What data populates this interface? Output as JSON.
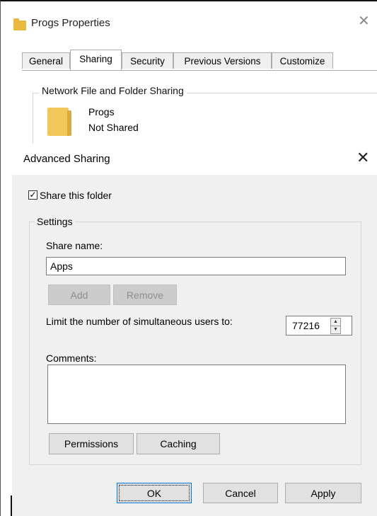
{
  "properties_window": {
    "title": "Progs Properties",
    "close_glyph": "✕",
    "tabs": [
      {
        "label": "General"
      },
      {
        "label": "Sharing",
        "active": true
      },
      {
        "label": "Security"
      },
      {
        "label": "Previous Versions"
      },
      {
        "label": "Customize"
      }
    ],
    "group_label": "Network File and Folder Sharing",
    "folder_name": "Progs",
    "share_status": "Not Shared",
    "icons": [
      "folder-icon"
    ]
  },
  "advanced_sharing": {
    "title": "Advanced Sharing",
    "close_glyph": "✕",
    "share_folder": {
      "label": "Share this folder",
      "checked": true
    },
    "settings_label": "Settings",
    "share_name_label": "Share name:",
    "share_name_value": "Apps",
    "add_label": "Add",
    "remove_label": "Remove",
    "limit_label": "Limit the number of simultaneous users to:",
    "limit_value": "77216",
    "comments_label": "Comments:",
    "comments_value": "",
    "permissions_label": "Permissions",
    "caching_label": "Caching",
    "ok_label": "OK",
    "cancel_label": "Cancel",
    "apply_label": "Apply"
  },
  "colors": {
    "dialog_bg": "#f0f0f0",
    "button_bg": "#e1e1e1",
    "disabled_button_bg": "#cccccc",
    "default_button_border": "#0078d7",
    "folder_yellow": "#f0c75a"
  }
}
